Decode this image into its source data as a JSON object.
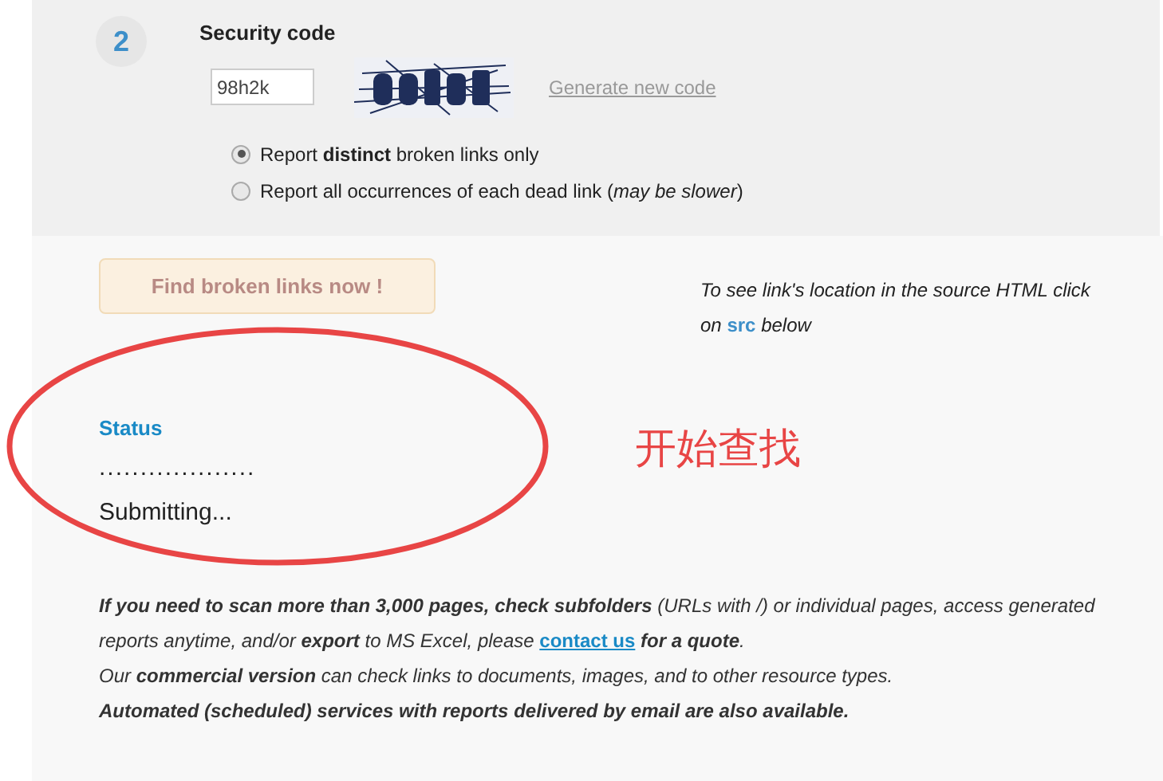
{
  "step": {
    "number": "2",
    "title": "Security code"
  },
  "code_field": {
    "value": "98h2k"
  },
  "generate_link": "Generate new code",
  "report_options": [
    {
      "text": "Report **distinct** broken links only",
      "selected": true
    },
    {
      "text": "Report all occurrences of each dead link (*may be slower*)",
      "selected": false
    }
  ],
  "find_button": {
    "label": "Find broken links now !",
    "disabled": true
  },
  "hint": {
    "before": "To see link's location in the source HTML click on",
    "link": "src",
    "after": "below"
  },
  "status": {
    "title": "Status",
    "progress": "...................",
    "message": "Submitting..."
  },
  "annotation": {
    "text": "开始查找"
  },
  "notes": [
    {
      "before": "**If you need to scan more than 3,000 pages, check subfolders** (URLs with /) or individual pages, access generated reports anytime, and/or **export** to MS Excel, please",
      "link": "contact us",
      "after": "**for a quote**."
    },
    {
      "before": "Our **commercial version** can check links to documents, images, and to other resource types."
    },
    {
      "before": "**Automated (scheduled) services with reports delivered by email are also available.**"
    }
  ]
}
